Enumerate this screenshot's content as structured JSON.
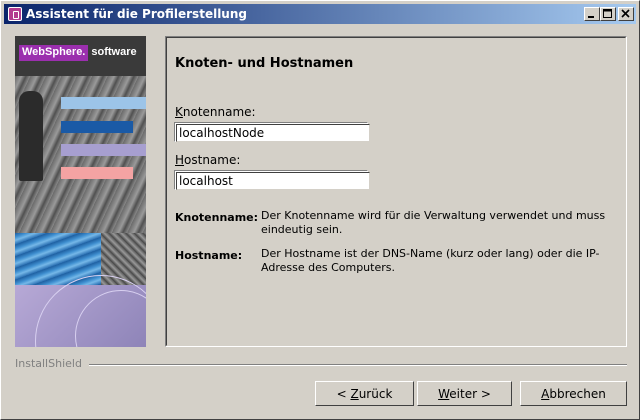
{
  "window": {
    "title": "Assistent für die Profilerstellung",
    "controls": [
      "minimize",
      "maximize",
      "close"
    ]
  },
  "banner": {
    "brand": "WebSphere.",
    "brand_suffix": "software",
    "stripe_colors": [
      "#9cc4e8",
      "#1a5aa6",
      "#a79fd0",
      "#f4a3a3"
    ]
  },
  "panel": {
    "heading": "Knoten- und Hostnamen",
    "nodename": {
      "label_accel": "K",
      "label_rest": "notenname:",
      "value": "localhostNode"
    },
    "hostname": {
      "label_accel": "H",
      "label_rest": "ostname:",
      "value": "localhost"
    },
    "descriptions": [
      {
        "term": "Knotenname:",
        "text": "Der Knotenname wird für die Verwaltung verwendet und muss eindeutig sein."
      },
      {
        "term": "Hostname:",
        "text": "Der Hostname ist der DNS-Name (kurz oder lang) oder die IP-Adresse des Computers."
      }
    ]
  },
  "footer": {
    "installshield": "InstallShield",
    "back": {
      "prefix": "< ",
      "accel": "Z",
      "rest": "urück"
    },
    "next": {
      "accel": "W",
      "rest": "eiter >"
    },
    "cancel": {
      "accel": "A",
      "rest": "bbrechen"
    }
  }
}
